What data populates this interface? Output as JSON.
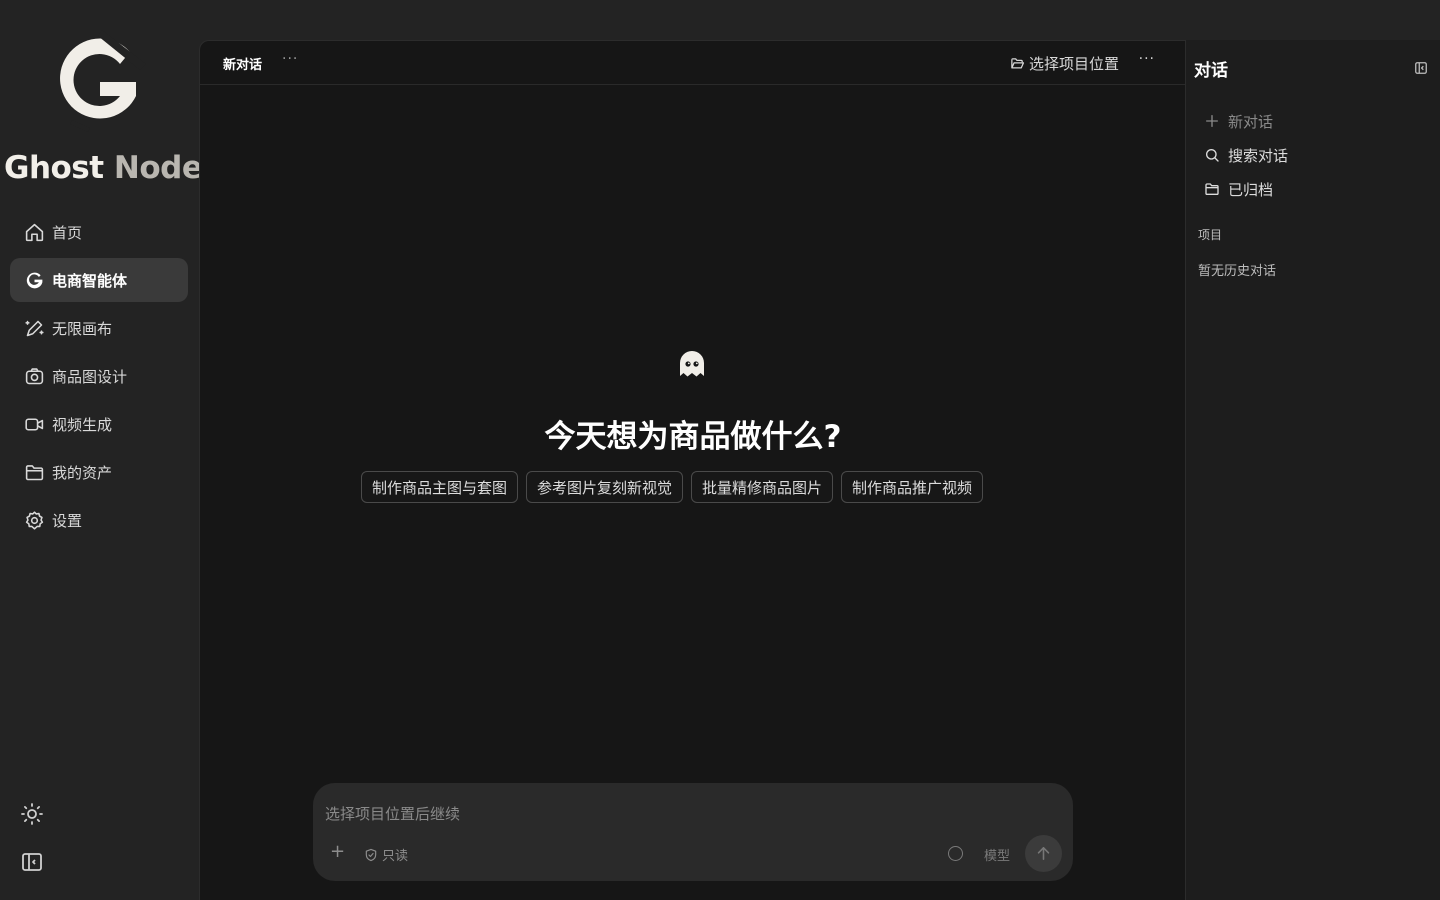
{
  "sidebar": {
    "brand_word1": "Ghost",
    "brand_word2": "Node",
    "items": [
      {
        "label": "首页",
        "icon": "home-icon"
      },
      {
        "label": "电商智能体",
        "icon": "g-logo-icon",
        "active": true
      },
      {
        "label": "无限画布",
        "icon": "magic-pen-icon"
      },
      {
        "label": "商品图设计",
        "icon": "camera-icon"
      },
      {
        "label": "视频生成",
        "icon": "video-icon"
      },
      {
        "label": "我的资产",
        "icon": "folder-icon"
      },
      {
        "label": "设置",
        "icon": "gear-icon"
      }
    ],
    "bottom_icons": [
      "sun-icon",
      "sidebar-toggle-icon"
    ]
  },
  "header": {
    "title": "新对话",
    "more": "···",
    "project_button": "选择项目位置",
    "more_right": "···"
  },
  "welcome": {
    "headline": "今天想为商品做什么?",
    "chips": [
      "制作商品主图与套图",
      "参考图片复刻新视觉",
      "批量精修商品图片",
      "制作商品推广视频"
    ]
  },
  "composer": {
    "placeholder": "选择项目位置后继续",
    "add": "+",
    "readonly_label": "只读",
    "model_label": "模型"
  },
  "right_panel": {
    "title": "对话",
    "actions": [
      {
        "label": "新对话",
        "icon": "plus-icon"
      },
      {
        "label": "搜索对话",
        "icon": "search-icon"
      },
      {
        "label": "已归档",
        "icon": "archive-folder-icon"
      }
    ],
    "section_label": "项目",
    "empty_text": "暂无历史对话"
  },
  "colors": {
    "sidebar_bg": "#232323",
    "main_bg": "#161616",
    "right_bg": "#1d1d1d",
    "active_item_bg": "#3a3a3a",
    "composer_bg": "#2a2a2a"
  }
}
